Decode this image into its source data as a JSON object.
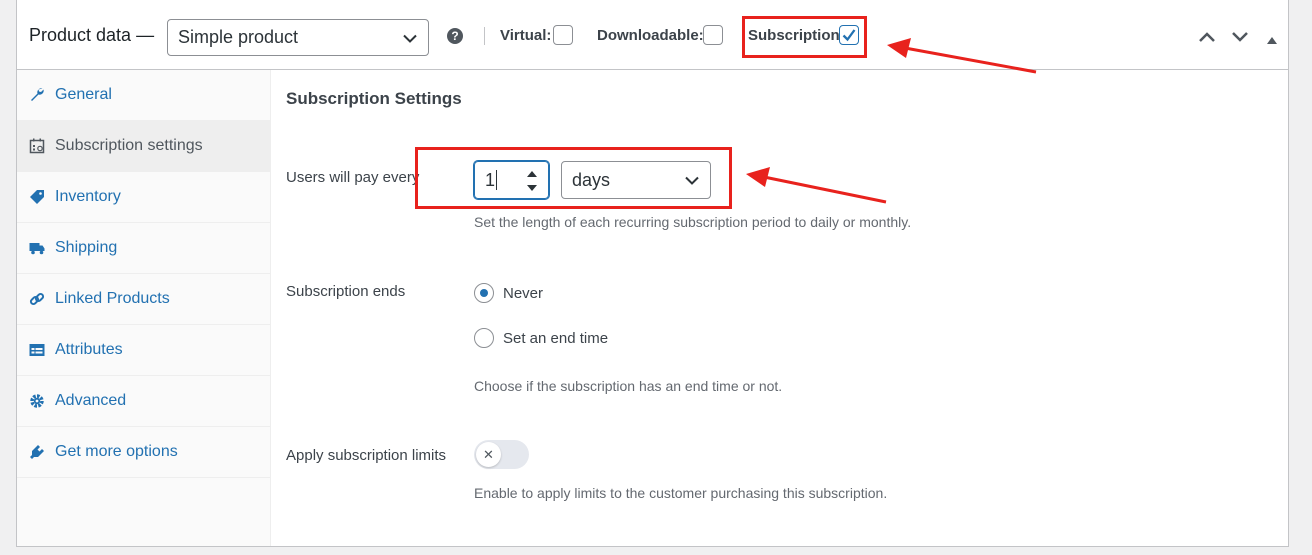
{
  "header": {
    "title": "Product data —",
    "product_type": "Simple product",
    "help": "?",
    "virtual_label": "Virtual:",
    "downloadable_label": "Downloadable:",
    "subscription_label": "Subscription:",
    "virtual_checked": false,
    "downloadable_checked": false,
    "subscription_checked": true
  },
  "tabs": [
    {
      "label": "General",
      "icon": "wrench-icon"
    },
    {
      "label": "Subscription settings",
      "icon": "calendar-icon"
    },
    {
      "label": "Inventory",
      "icon": "tag-icon"
    },
    {
      "label": "Shipping",
      "icon": "truck-icon"
    },
    {
      "label": "Linked Products",
      "icon": "link-icon"
    },
    {
      "label": "Attributes",
      "icon": "table-icon"
    },
    {
      "label": "Advanced",
      "icon": "gear-icon"
    },
    {
      "label": "Get more options",
      "icon": "plugin-icon"
    }
  ],
  "active_tab": "Subscription settings",
  "content": {
    "section_title": "Subscription Settings",
    "pay_every_label": "Users will pay every",
    "pay_every_value": "1",
    "period_value": "days",
    "pay_every_hint": "Set the length of each recurring subscription period to daily or monthly.",
    "ends_label": "Subscription ends",
    "ends_options": [
      "Never",
      "Set an end time"
    ],
    "ends_selected": "Never",
    "ends_hint": "Choose if the subscription has an end time or not.",
    "limits_label": "Apply subscription limits",
    "limits_enabled": false,
    "limits_hint": "Enable to apply limits to the customer purchasing this subscription."
  },
  "colors": {
    "accent": "#2271b1",
    "annotation_red": "#e8221d"
  }
}
